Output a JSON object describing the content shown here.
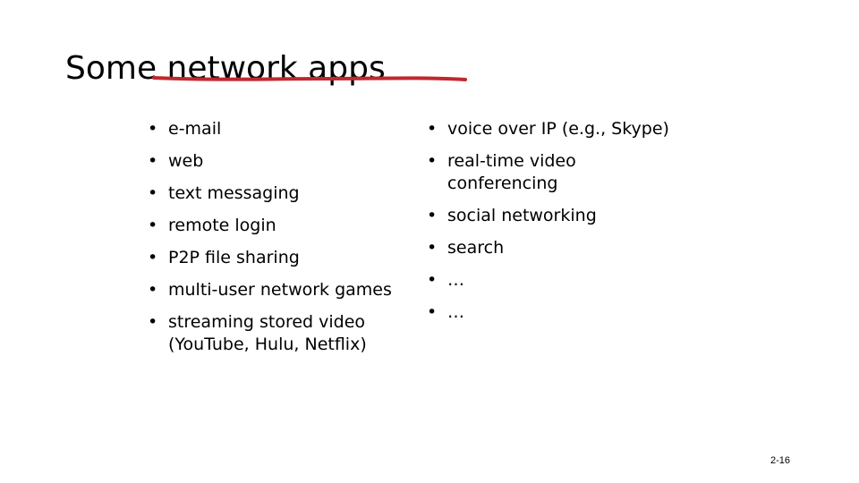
{
  "slide": {
    "title": "Some network apps",
    "annotation_color": "#c0282d",
    "left_list": [
      {
        "text": "e-mail"
      },
      {
        "text": "web"
      },
      {
        "text": "text messaging"
      },
      {
        "text": "remote login"
      },
      {
        "text": "P2P file sharing"
      },
      {
        "text": "multi-user network games"
      },
      {
        "text": "streaming stored video (YouTube, Hulu, Netflix)"
      }
    ],
    "right_list": [
      {
        "text": "voice over IP (e.g., Skype)"
      },
      {
        "text": "real-time video conferencing"
      },
      {
        "text": "social networking"
      },
      {
        "text": "search"
      },
      {
        "text": "…"
      },
      {
        "text": "…"
      }
    ],
    "bullet_glyph": "•",
    "page_number": "2-16"
  }
}
